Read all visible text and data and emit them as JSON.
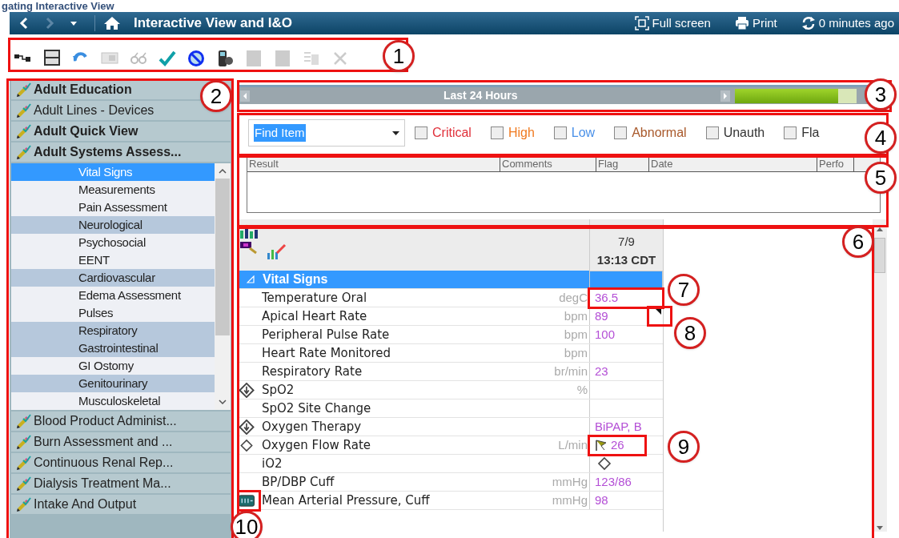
{
  "doc_heading": "gating Interactive View",
  "titlebar": {
    "title": "Interactive View and I&O",
    "actions": [
      {
        "kind": "fullscreen",
        "label": "Full screen"
      },
      {
        "kind": "print",
        "label": "Print"
      },
      {
        "kind": "refresh",
        "label": "0 minutes ago"
      }
    ]
  },
  "toolbar": [
    {
      "disabled": false
    },
    {
      "disabled": false
    },
    {
      "disabled": false
    },
    {
      "disabled": true
    },
    {
      "disabled": true
    },
    {
      "disabled": false
    },
    {
      "disabled": false
    },
    {
      "disabled": false
    },
    {
      "disabled": true
    },
    {
      "disabled": true
    },
    {
      "disabled": true
    },
    {
      "disabled": true
    }
  ],
  "sidebar": {
    "sections": [
      {
        "label": "Adult Education",
        "bold": true
      },
      {
        "label": "Adult Lines - Devices",
        "bold": false
      },
      {
        "label": "Adult Quick View",
        "bold": true
      },
      {
        "label": "Adult Systems Assess...",
        "bold": true,
        "children": [
          {
            "label": "Vital Signs",
            "selected": true,
            "documented": false
          },
          {
            "label": "Measurements",
            "selected": false,
            "documented": false
          },
          {
            "label": "Pain Assessment",
            "selected": false,
            "documented": false
          },
          {
            "label": "Neurological",
            "selected": false,
            "documented": true
          },
          {
            "label": "Psychosocial",
            "selected": false,
            "documented": false
          },
          {
            "label": "EENT",
            "selected": false,
            "documented": false
          },
          {
            "label": "Cardiovascular",
            "selected": false,
            "documented": true
          },
          {
            "label": "Edema Assessment",
            "selected": false,
            "documented": false
          },
          {
            "label": "Pulses",
            "selected": false,
            "documented": false
          },
          {
            "label": "Respiratory",
            "selected": false,
            "documented": true
          },
          {
            "label": "Gastrointestinal",
            "selected": false,
            "documented": true
          },
          {
            "label": "GI Ostomy",
            "selected": false,
            "documented": false
          },
          {
            "label": "Genitourinary",
            "selected": false,
            "documented": true
          },
          {
            "label": "Musculoskeletal",
            "selected": false,
            "documented": false
          }
        ]
      },
      {
        "label": "Blood Product Administ...",
        "bold": false
      },
      {
        "label": "Burn Assessment and ...",
        "bold": false
      },
      {
        "label": "Continuous Renal Rep...",
        "bold": false
      },
      {
        "label": "Dialysis Treatment Ma...",
        "bold": false
      },
      {
        "label": "Intake And Output",
        "bold": false
      }
    ]
  },
  "timebar": {
    "label": "Last 24 Hours",
    "level": 0.85
  },
  "filters": {
    "find": {
      "value": "Find Item"
    },
    "options": [
      {
        "label": "Critical",
        "checked": false,
        "color": "#e0303a"
      },
      {
        "label": "High",
        "checked": false,
        "color": "#f07a20"
      },
      {
        "label": "Low",
        "checked": false,
        "color": "#4a90e8"
      },
      {
        "label": "Abnormal",
        "checked": false,
        "color": "#a8582a"
      },
      {
        "label": "Unauth",
        "checked": false,
        "color": "#333333"
      },
      {
        "label": "Fla",
        "checked": false,
        "color": "#333333"
      }
    ]
  },
  "results_table": {
    "columns": [
      "Result",
      "Comments",
      "Flag",
      "Date",
      "Perfo"
    ]
  },
  "flowsheet": {
    "date": "7/9",
    "time": "13:13 CDT",
    "rows": [
      {
        "kind": "section",
        "label": "Vital Signs",
        "selected": true,
        "unit": "",
        "value": "",
        "flagged": false,
        "commented": false,
        "pending": false
      },
      {
        "kind": "plain",
        "label": "Temperature Oral",
        "selected": false,
        "unit": "degC",
        "value": "36.5",
        "flagged": false,
        "commented": false,
        "pending": false
      },
      {
        "kind": "plain",
        "label": "Apical Heart Rate",
        "selected": false,
        "unit": "bpm",
        "value": "89",
        "flagged": false,
        "commented": true,
        "pending": false
      },
      {
        "kind": "plain",
        "label": "Peripheral Pulse Rate",
        "selected": false,
        "unit": "bpm",
        "value": "100",
        "flagged": false,
        "commented": false,
        "pending": false
      },
      {
        "kind": "plain",
        "label": "Heart Rate Monitored",
        "selected": false,
        "unit": "bpm",
        "value": "",
        "flagged": false,
        "commented": false,
        "pending": false
      },
      {
        "kind": "plain",
        "label": "Respiratory Rate",
        "selected": false,
        "unit": "br/min",
        "value": "23",
        "flagged": false,
        "commented": false,
        "pending": false
      },
      {
        "kind": "dropdown",
        "label": "SpO2",
        "selected": false,
        "unit": "%",
        "value": "",
        "flagged": false,
        "commented": false,
        "pending": false
      },
      {
        "kind": "plain",
        "label": "SpO2 Site Change",
        "selected": false,
        "unit": "",
        "value": "",
        "flagged": false,
        "commented": false,
        "pending": false
      },
      {
        "kind": "dropdown",
        "label": "Oxygen Therapy",
        "selected": false,
        "unit": "",
        "value": "BiPAP, B",
        "flagged": false,
        "commented": false,
        "pending": false
      },
      {
        "kind": "optional",
        "label": "Oxygen Flow Rate",
        "selected": false,
        "unit": "L/min",
        "value": "26",
        "flagged": true,
        "commented": false,
        "pending": false
      },
      {
        "kind": "plain",
        "label": "iO2",
        "selected": false,
        "unit": "",
        "value": "",
        "flagged": false,
        "commented": false,
        "pending": true
      },
      {
        "kind": "plain",
        "label": "BP/DBP Cuff",
        "selected": false,
        "unit": "mmHg",
        "value": "123/86",
        "flagged": false,
        "commented": false,
        "pending": false
      },
      {
        "kind": "calculated",
        "label": "Mean Arterial Pressure, Cuff",
        "selected": false,
        "unit": "mmHg",
        "value": "98",
        "flagged": false,
        "commented": false,
        "pending": false
      }
    ]
  },
  "callouts": [
    {
      "label": "1"
    },
    {
      "label": "2"
    },
    {
      "label": "3"
    },
    {
      "label": "4"
    },
    {
      "label": "5"
    },
    {
      "label": "6"
    },
    {
      "label": "7"
    },
    {
      "label": "8"
    },
    {
      "label": "9"
    },
    {
      "label": "10"
    }
  ]
}
